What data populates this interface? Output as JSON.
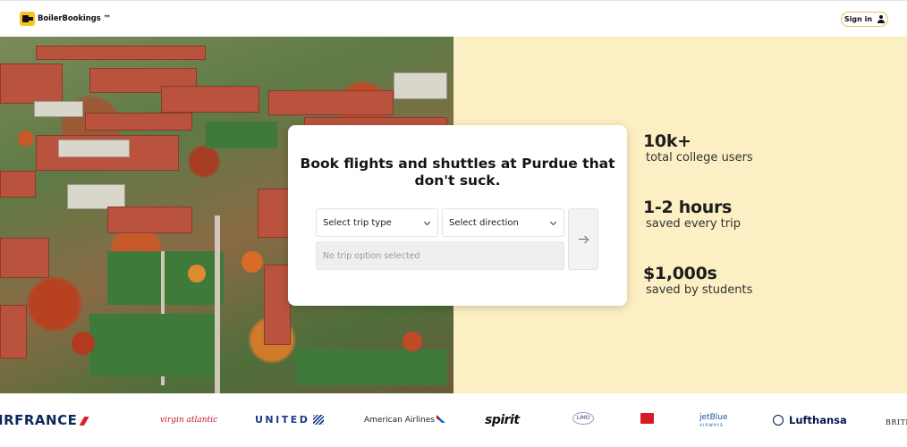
{
  "brand": {
    "name": "BoilerBookings ™",
    "logo_color": "#f7c320"
  },
  "header": {
    "signin_label": "Sign in",
    "signin_icon": "user-icon"
  },
  "hero": {
    "image_description_icon": "campus-aerial-photo",
    "background_color": "#fcefc3"
  },
  "booking_card": {
    "title": "Book flights and shuttles at Purdue that don't suck.",
    "trip_type_select": {
      "value": "Select trip type",
      "icon": "chevron-down-icon"
    },
    "direction_select": {
      "value": "Select direction",
      "icon": "chevron-down-icon"
    },
    "trip_option_placeholder": "No trip option selected",
    "go_button_icon": "arrow-right-icon"
  },
  "stats": [
    {
      "value": "10k+",
      "label": "total college users"
    },
    {
      "value": "1-2 hours",
      "label": "saved every trip"
    },
    {
      "value": "$1,000s",
      "label": "saved by students"
    }
  ],
  "partners": {
    "airfrance": "IRFRANCE",
    "virgin": "virgin atlantic",
    "united": "UNITED",
    "american": "American Airlines",
    "spirit": "spirit",
    "limo": "LIMO",
    "jetblue": "jetBlue",
    "jetblue_sub": "AIRWAYS",
    "lufthansa": "Lufthansa",
    "british": "BRITIS"
  }
}
